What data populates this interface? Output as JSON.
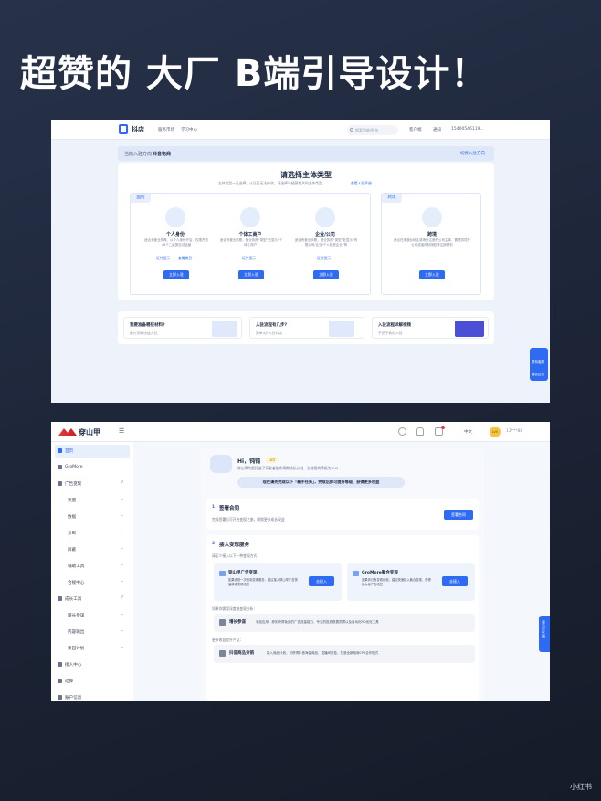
{
  "poster": {
    "title": "超赞的 大厂 B端引导设计！",
    "watermark": "小红书"
  },
  "shot1": {
    "logo": "抖店",
    "nav": [
      "服务市场",
      "学习中心"
    ],
    "search_placeholder": "搜索功能/服务",
    "header_items": [
      "客户端",
      "通知",
      "15400546119..."
    ],
    "entry_label": "当前入驻方向：",
    "entry_value": "抖音电商",
    "switch_label": "切换入驻方向",
    "heading": "请选择主体类型",
    "subheading": "主体类型一旦选择，认证后无法修改。请选择与经营相关的主体类型",
    "subheading_link": "查看入驻手册",
    "domestic_tag": "国内",
    "cross_tag": "跨境",
    "types": [
      {
        "name": "个人身份",
        "desc": "适合无营业执照、以个人身份开店，仅限开放48个二级类目试运营",
        "link1": "证件图示",
        "link2": "查看类目",
        "btn": "立即入驻"
      },
      {
        "name": "个体工商户",
        "desc": "适合有营业执照，营业执照“类型”处显示“个体工商户”",
        "link1": "证件图示",
        "btn": "立即入驻"
      },
      {
        "name": "企业/公司",
        "desc": "适合有营业执照，营业执照“类型”处显示“有限公司/企业/个人独资企业”等",
        "link1": "证件图示",
        "btn": "立即入驻"
      },
      {
        "name": "跨境",
        "desc": "适合在港澳台地区或海外注册的公司主体，需提供境外公司或者商标授权等注册材料",
        "btn": "立即入驻"
      }
    ],
    "tips": [
      {
        "title": "我要准备哪些材料?",
        "sub": "备齐资料快速入驻"
      },
      {
        "title": "入驻流程有几步?",
        "sub": "简单4步入驻抖店"
      },
      {
        "title": "入驻流程详解视频",
        "sub": "手把手教你入驻"
      }
    ],
    "float": [
      "联系客服",
      "建议反馈"
    ]
  },
  "shot2": {
    "logo": "穿山甲",
    "header_right": [
      "中文",
      "LV0",
      "13***88"
    ],
    "menu": [
      {
        "label": "首页",
        "active": true,
        "icon": "home-icon"
      },
      {
        "label": "GroMore",
        "icon": "gromore-icon"
      },
      {
        "label": "广告变现",
        "icon": "ad-icon",
        "group": true
      },
      {
        "label": "流量",
        "sub": true
      },
      {
        "label": "数据",
        "sub": true
      },
      {
        "label": "诊断",
        "sub": true
      },
      {
        "label": "屏蔽",
        "sub": true
      },
      {
        "label": "辅助工具",
        "sub": true
      },
      {
        "label": "合规中心",
        "sub": true
      },
      {
        "label": "成长工具",
        "icon": "grow-icon",
        "group": true
      },
      {
        "label": "增长参谋",
        "sub": true
      },
      {
        "label": "内容输出",
        "sub": true
      },
      {
        "label": "果园计划",
        "sub": true
      },
      {
        "label": "接入中心",
        "icon": "connect-icon"
      },
      {
        "label": "结算",
        "icon": "money-icon"
      },
      {
        "label": "账户信息",
        "icon": "user-icon"
      }
    ],
    "greeting": "Hi，钝钝",
    "level": "LV0",
    "welcome": "穿山甲为您打造了开发者生命周期成长计划，当前您的等级为 LV0",
    "task_banner": "现在请先完成以下「新手任务」，完成后即可提升等级、获得更多权益",
    "step1": {
      "num": "1",
      "title": "签署合同",
      "desc": "完成签署后可开启变现之旅，解锁更多成长权益",
      "btn": "签署合同"
    },
    "step2": {
      "num": "2",
      "title": "接入变现服务",
      "desc": "请至少接入以下一种变现方式：",
      "options": [
        {
          "title": "穿山甲广告变现",
          "desc": "如果你是一次使用变现服务，建议接入穿山甲广告快速获得变现收益",
          "btn": "去接入"
        },
        {
          "title": "GroMore聚合变现",
          "desc": "如果你已有变现经验，建议快速接入聚合变现，获得最大化广告收益",
          "btn": "去接入"
        }
      ],
      "more_label": "如果你需要深度造变现分析：",
      "growth_title": "增长参谋",
      "growth_desc": "添加应用，即刻获得免费的广告流量能力、专业的投放数据洞察以及自动化RD优化工具",
      "extra_label": "更多收益提升产品：",
      "ecom_title": "抖音商品分销",
      "ecom_desc": "接入商品计划，可获得抖音海量商品，直播间货挂，打造全新电商CPS合作模式"
    },
    "float": "意见反馈"
  }
}
